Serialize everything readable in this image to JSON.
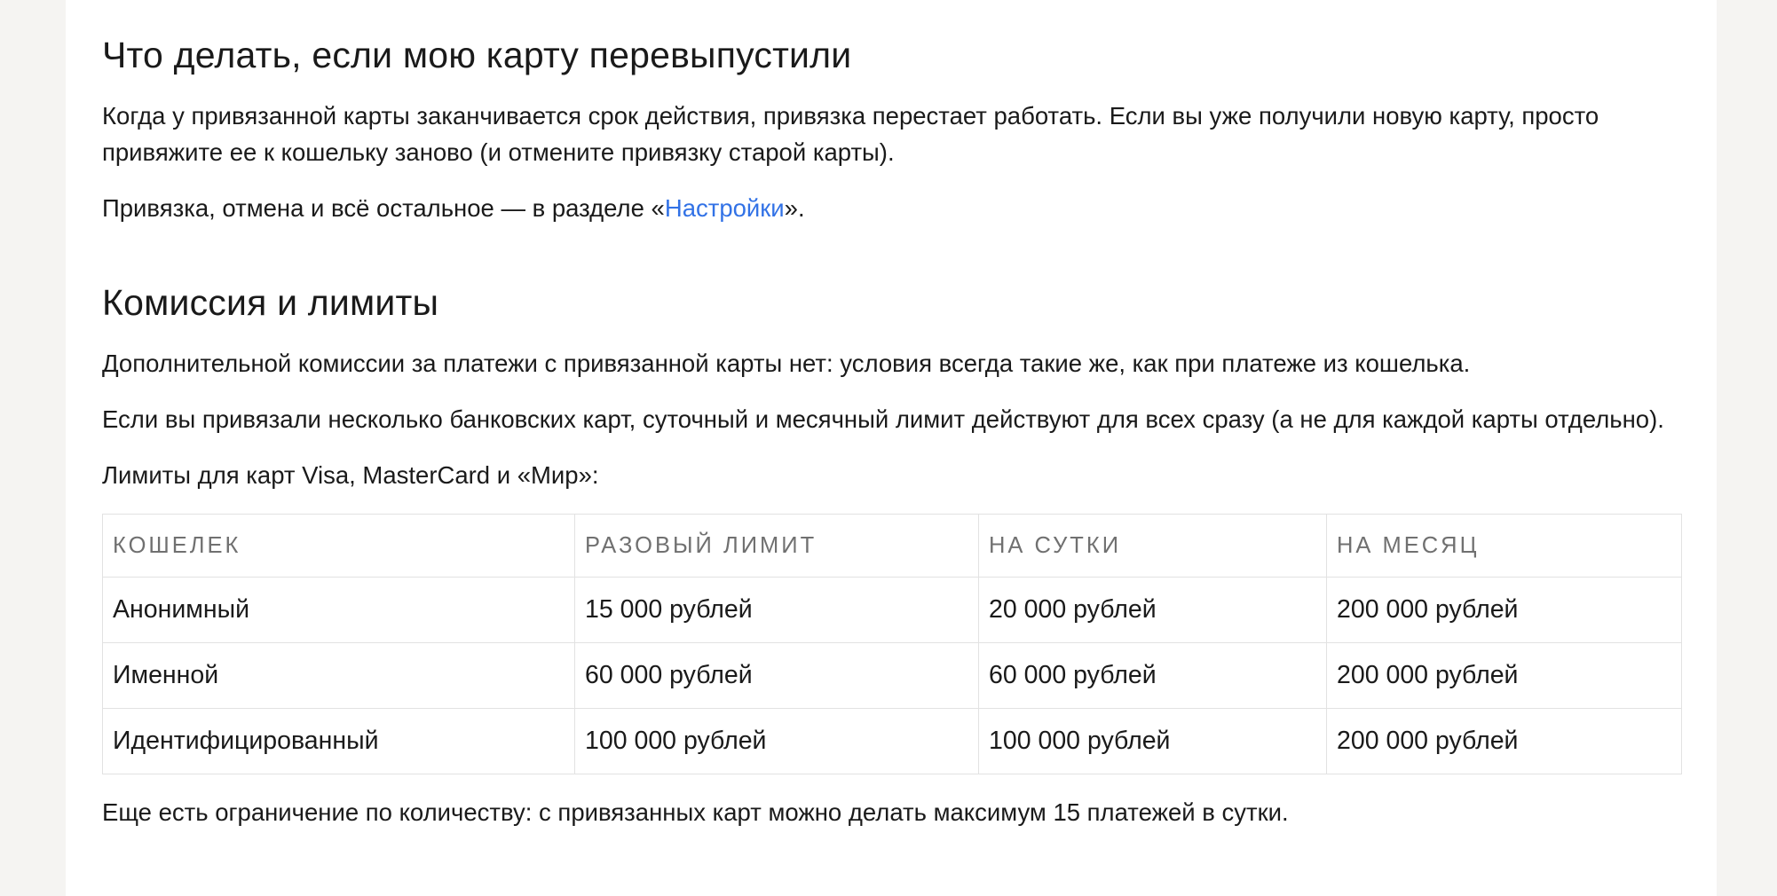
{
  "reissue": {
    "heading": "Что делать, если мою карту перевыпустили",
    "paragraph1": "Когда у привязанной карты заканчивается срок действия, привязка перестает работать. Если вы уже получили новую карту, просто привяжите ее к кошельку заново (и отмените привязку старой карты).",
    "settings_text_before": "Привязка, отмена и всё остальное — в разделе «",
    "settings_link": "Настройки",
    "settings_text_after": "»."
  },
  "fees": {
    "heading": "Комиссия и лимиты",
    "paragraph1": "Дополнительной комиссии за платежи с привязанной карты нет: условия всегда такие же, как при платеже из кошелька.",
    "paragraph2": "Если вы привязали несколько банковских карт, суточный и месячный лимит действуют для всех сразу (а не для каждой карты отдельно).",
    "table_caption": "Лимиты для карт Visa, MasterCard и «Мир»:",
    "table": {
      "headers": [
        "КОШЕЛЕК",
        "РАЗОВЫЙ ЛИМИТ",
        "НА СУТКИ",
        "НА МЕСЯЦ"
      ],
      "rows": [
        [
          "Анонимный",
          "15 000 рублей",
          "20 000 рублей",
          "200 000 рублей"
        ],
        [
          "Именной",
          "60 000 рублей",
          "60 000 рублей",
          "200 000 рублей"
        ],
        [
          "Идентифицированный",
          "100 000 рублей",
          "100 000 рублей",
          "200 000 рублей"
        ]
      ]
    },
    "footnote": "Еще есть ограничение по количеству: с привязанных карт можно делать максимум 15 платежей в сутки."
  },
  "colors": {
    "background": "#f5f4f2",
    "page": "#ffffff",
    "text": "#1a1a1a",
    "link": "#3272e6",
    "table_header_text": "#707070",
    "table_border": "#e2e2e2"
  }
}
